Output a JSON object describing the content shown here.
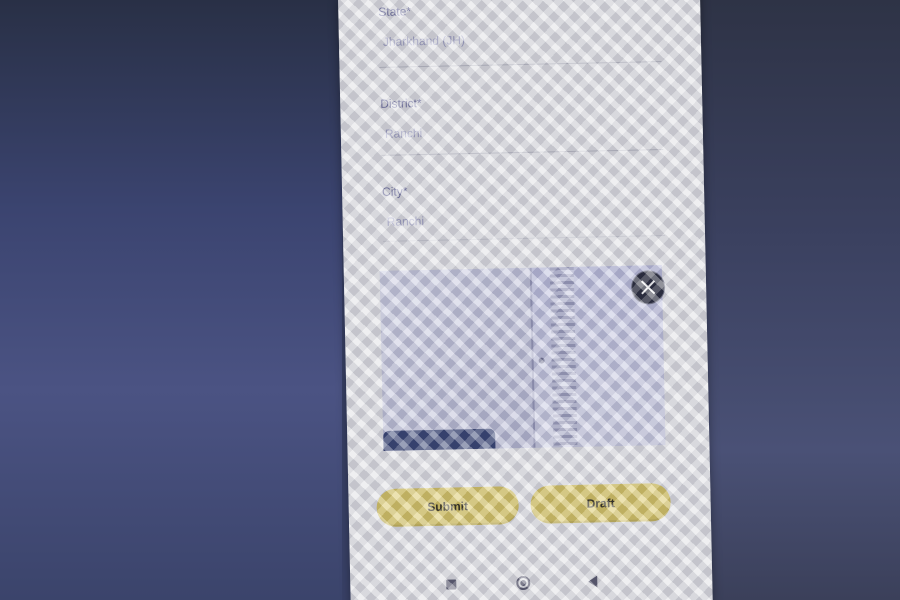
{
  "form": {
    "state": {
      "label": "State*",
      "value": "Jharkhand (JH)"
    },
    "district": {
      "label": "District*",
      "value": "Ranchi"
    },
    "city": {
      "label": "City*",
      "value": "Ranchi"
    }
  },
  "photo": {
    "remove_icon": "close-icon"
  },
  "actions": {
    "submit_label": "Submit",
    "draft_label": "Draft"
  },
  "system_nav": {
    "recents_icon": "square-icon",
    "home_icon": "circle-icon",
    "back_icon": "triangle-back-icon"
  },
  "colors": {
    "button_fill": "#d8c55f",
    "label_text": "#6e6f9e",
    "value_text": "#9b9cc0"
  }
}
